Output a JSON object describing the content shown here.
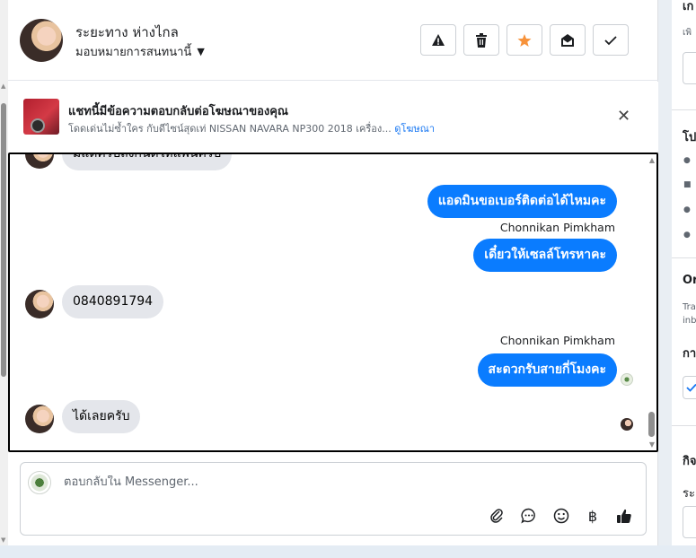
{
  "header": {
    "contact_name": "ระยะทาง ห่างไกล",
    "assign_label": "มอบหมายการสนทนานี้",
    "actions": [
      {
        "name": "report-button",
        "icon": "warning-icon",
        "glyph": "⚠"
      },
      {
        "name": "delete-button",
        "icon": "trash-icon",
        "glyph": "🗑"
      },
      {
        "name": "star-button",
        "icon": "star-icon",
        "glyph": "★",
        "color": "#f7923a"
      },
      {
        "name": "mark-unread-button",
        "icon": "envelope-open-icon",
        "glyph": "✉"
      },
      {
        "name": "mark-done-button",
        "icon": "check-icon",
        "glyph": "✓"
      }
    ]
  },
  "ad_banner": {
    "title": "แชทนี้มีข้อความตอบกลับต่อโฆษณาของคุณ",
    "subtitle": "โดดเด่นไม่ซ้ำใคร กับดีไซน์สุดเท่ NISSAN NAVARA NP300 2018 เครื่อง...",
    "link": "ดูโฆษณา",
    "close_glyph": "✕"
  },
  "chat": {
    "partial_top_text": "มีแต่ครับถึงกันดีให้แพ้นครับ",
    "messages": [
      {
        "direction": "out",
        "text": "แอดมินขอเบอร์ติดต่อได้ไหมคะ"
      },
      {
        "direction": "out",
        "sender": "Chonnikan Pimkham",
        "text": "เดี๋ยวให้เซลล์โทรหาคะ"
      },
      {
        "direction": "in",
        "text": "0840891794"
      },
      {
        "direction": "out",
        "sender": "Chonnikan Pimkham",
        "text": "สะดวกรับสายกี่โมงคะ"
      },
      {
        "direction": "in",
        "text": "ได้เลยครับ"
      }
    ]
  },
  "composer": {
    "placeholder": "ตอบกลับใน Messenger...",
    "tools": [
      {
        "name": "attach-button",
        "icon": "paperclip-icon",
        "glyph": "📎"
      },
      {
        "name": "saved-reply-button",
        "icon": "chat-bubble-icon",
        "glyph": "💬"
      },
      {
        "name": "emoji-button",
        "icon": "smiley-icon",
        "glyph": "☺"
      },
      {
        "name": "payment-button",
        "icon": "baht-icon",
        "glyph": "฿"
      },
      {
        "name": "like-button",
        "icon": "thumbs-up-icon",
        "glyph": "👍"
      }
    ]
  },
  "right_panel": {
    "heading_1": "เก",
    "small_1": "เพิ",
    "heading_2": "โป",
    "heading_3": "Or",
    "small_3a": "Tra",
    "small_3b": "inb",
    "heading_4": "กา",
    "heading_5": "กิจ",
    "small_5": "ระ"
  },
  "colors": {
    "accent": "#0a7cff",
    "link": "#1877f2",
    "star": "#f7923a"
  }
}
